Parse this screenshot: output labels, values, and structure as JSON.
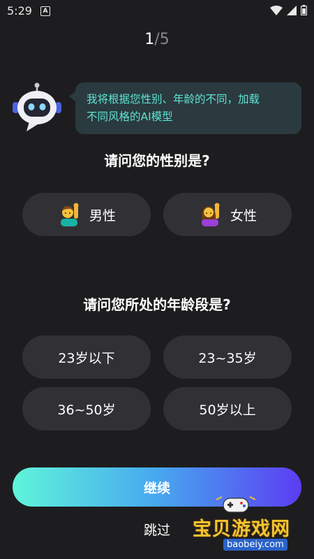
{
  "status_bar": {
    "time": "5:29",
    "notification_badge": "A"
  },
  "progress": {
    "current": "1",
    "separator": "/",
    "total": "5"
  },
  "assistant": {
    "message_line1": "我将根据您性别、年龄的不同，加载",
    "message_line2": "不同风格的AI模型"
  },
  "gender": {
    "question": "请问您的性别是?",
    "options": [
      {
        "label": "男性",
        "icon": "man-raising-hand-icon"
      },
      {
        "label": "女性",
        "icon": "woman-raising-hand-icon"
      }
    ]
  },
  "age": {
    "question": "请问您所处的年龄段是?",
    "options": [
      {
        "label": "23岁以下"
      },
      {
        "label": "23~35岁"
      },
      {
        "label": "36~50岁"
      },
      {
        "label": "50岁以上"
      }
    ]
  },
  "actions": {
    "continue_label": "继续",
    "skip_label": "跳过"
  },
  "watermark": {
    "brand": "宝贝游戏网",
    "url": "baobeiy.com"
  },
  "colors": {
    "background": "#1d1d1f",
    "option_background": "#313135",
    "bubble_background": "#2a3a3f",
    "bubble_text": "#5fe3d2",
    "gradient_start": "#5ff5da",
    "gradient_end": "#5b3df2"
  }
}
